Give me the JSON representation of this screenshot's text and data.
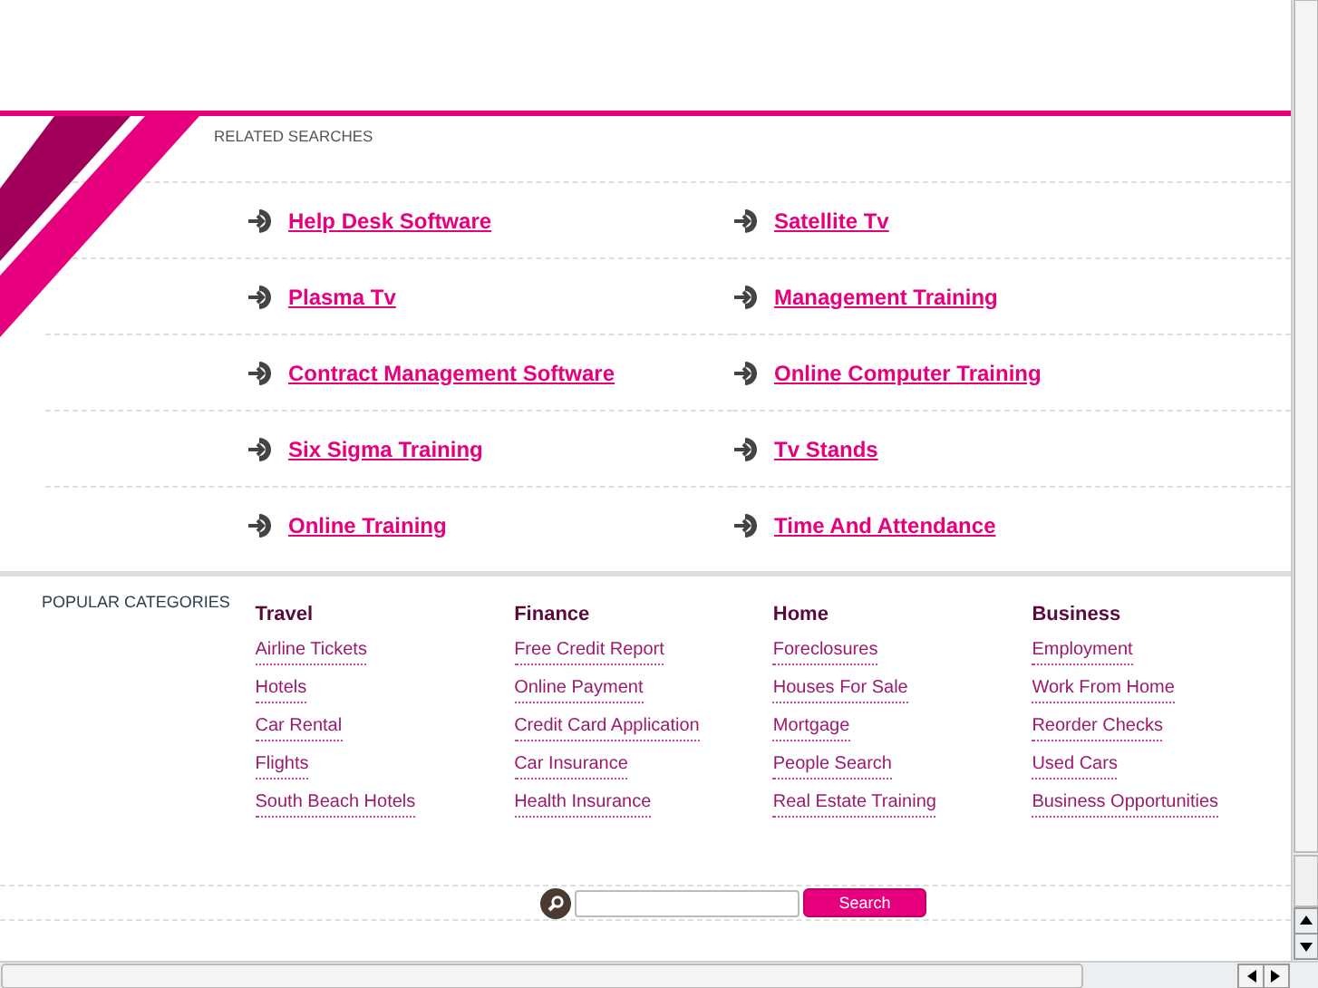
{
  "related_searches": {
    "title": "RELATED SEARCHES",
    "links": [
      {
        "label": "Help Desk Software"
      },
      {
        "label": "Satellite Tv"
      },
      {
        "label": "Plasma Tv"
      },
      {
        "label": "Management Training"
      },
      {
        "label": "Contract Management Software"
      },
      {
        "label": "Online Computer Training"
      },
      {
        "label": "Six Sigma Training"
      },
      {
        "label": "Tv Stands"
      },
      {
        "label": "Online Training"
      },
      {
        "label": "Time And Attendance"
      }
    ]
  },
  "popular_categories": {
    "title": "POPULAR CATEGORIES",
    "columns": [
      {
        "heading": "Travel",
        "links": [
          "Airline Tickets",
          "Hotels",
          "Car Rental",
          "Flights",
          "South Beach Hotels"
        ]
      },
      {
        "heading": "Finance",
        "links": [
          "Free Credit Report",
          "Online Payment",
          "Credit Card Application",
          "Car Insurance",
          "Health Insurance"
        ]
      },
      {
        "heading": "Home",
        "links": [
          "Foreclosures",
          "Houses For Sale",
          "Mortgage",
          "People Search",
          "Real Estate Training"
        ]
      },
      {
        "heading": "Business",
        "links": [
          "Employment",
          "Work From Home",
          "Reorder Checks",
          "Used Cars",
          "Business Opportunities"
        ]
      }
    ]
  },
  "search": {
    "button": "Search"
  }
}
